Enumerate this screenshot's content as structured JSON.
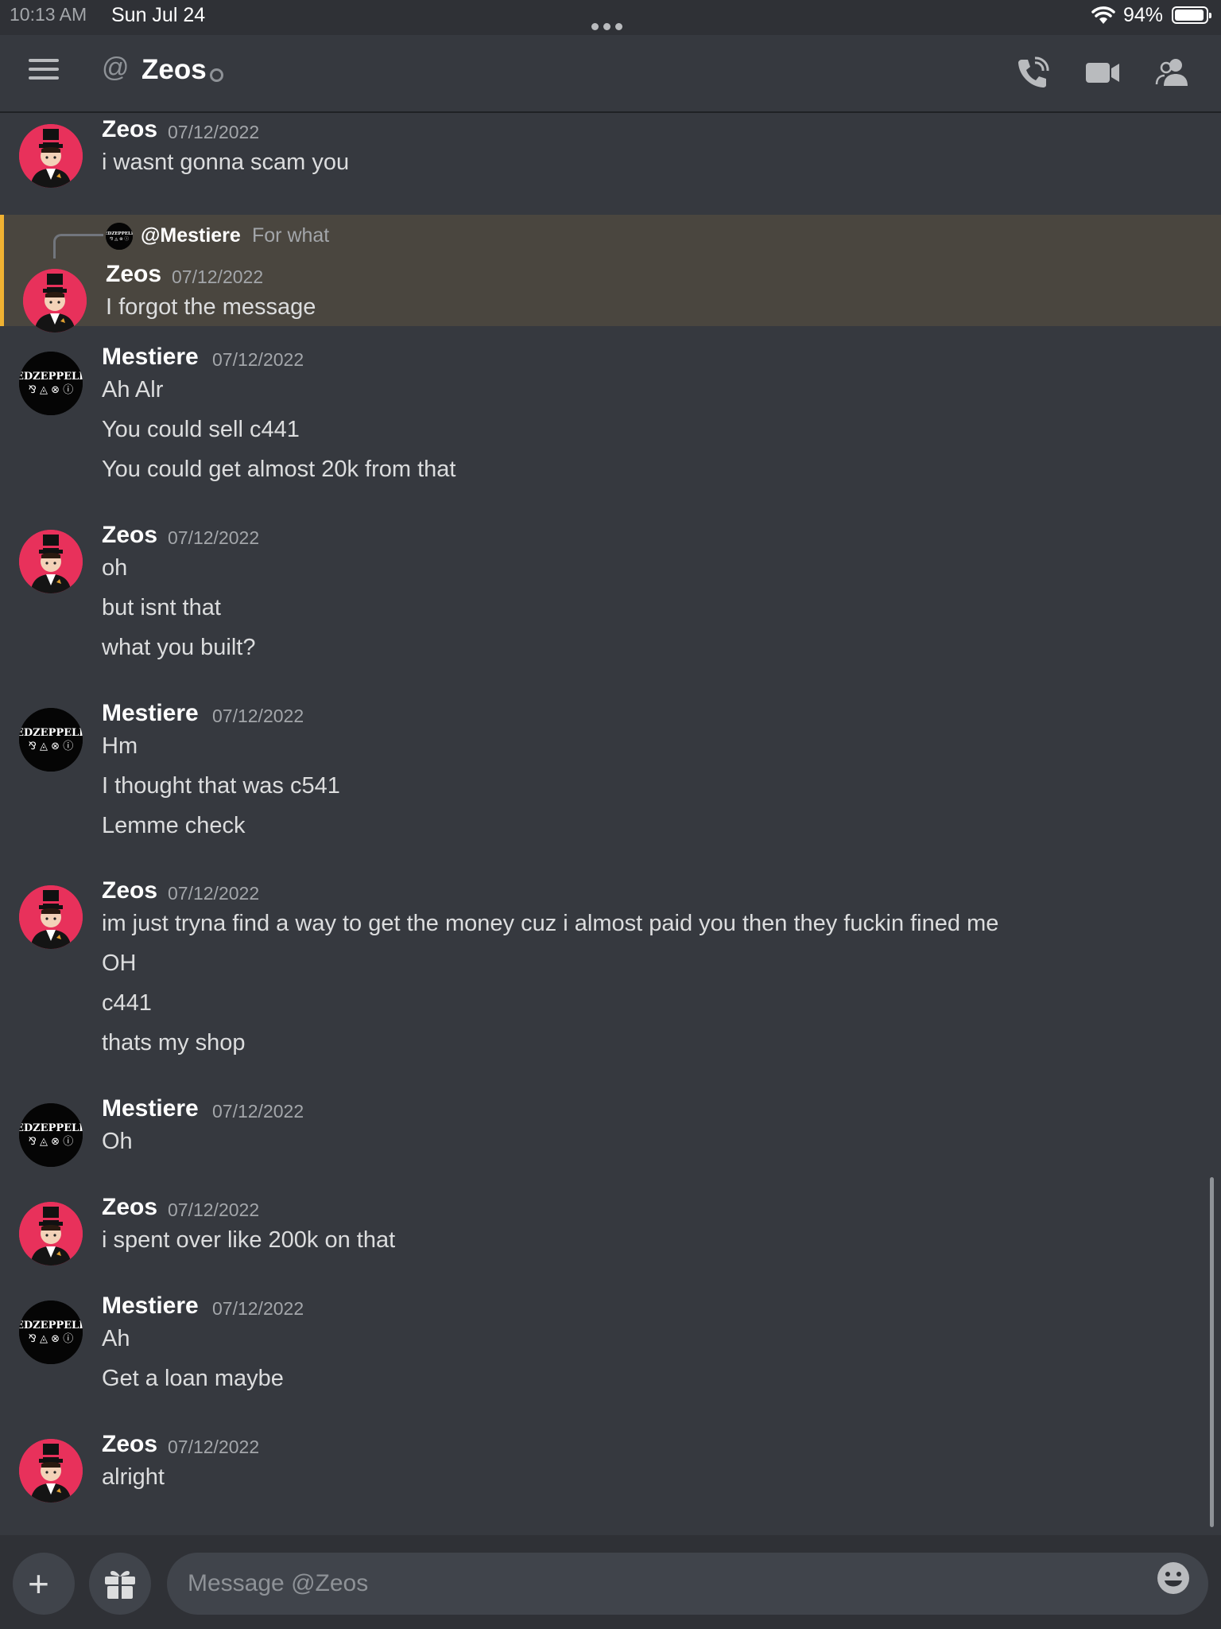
{
  "status_bar": {
    "time": "10:13 AM",
    "date": "Sun Jul 24",
    "battery": "94%",
    "battery_level": 0.94
  },
  "header": {
    "title": "Zeos",
    "icons": [
      "menu-icon",
      "at-icon",
      "call-icon",
      "video-icon",
      "members-icon"
    ]
  },
  "messages": [
    {
      "author": "Zeos",
      "time": "07/12/2022",
      "lines": [
        "i wasnt gonna scam you"
      ]
    },
    {
      "author": "Zeos",
      "time": "07/12/2022",
      "lines": [
        "I forgot the message"
      ],
      "reply": {
        "name": "@Mestiere",
        "text": "For what"
      },
      "highlighted": true
    },
    {
      "author": "Mestiere",
      "time": "07/12/2022",
      "lines": [
        "Ah Alr",
        "You could sell c441",
        "You could get almost 20k from that"
      ]
    },
    {
      "author": "Zeos",
      "time": "07/12/2022",
      "lines": [
        "oh",
        "but isnt that",
        "what you built?"
      ]
    },
    {
      "author": "Mestiere",
      "time": "07/12/2022",
      "lines": [
        "Hm",
        "I thought that was c541",
        "Lemme check"
      ]
    },
    {
      "author": "Zeos",
      "time": "07/12/2022",
      "lines": [
        "im just tryna find a way to get the money cuz i almost paid you then they fuckin fined me",
        "OH",
        "c441",
        "thats my shop"
      ]
    },
    {
      "author": "Mestiere",
      "time": "07/12/2022",
      "lines": [
        "Oh"
      ]
    },
    {
      "author": "Zeos",
      "time": "07/12/2022",
      "lines": [
        "i spent over like 200k on that"
      ]
    },
    {
      "author": "Mestiere",
      "time": "07/12/2022",
      "lines": [
        "Ah",
        "Get a loan maybe"
      ]
    },
    {
      "author": "Zeos",
      "time": "07/12/2022",
      "lines": [
        "alright"
      ]
    }
  ],
  "input": {
    "placeholder": "Message @Zeos"
  },
  "colors": {
    "background": "#36393f",
    "highlight_bg": "#4a463f",
    "highlight_border": "#f0b232",
    "zeos_avatar": "#e8315b",
    "mestiere_avatar": "#050505"
  }
}
